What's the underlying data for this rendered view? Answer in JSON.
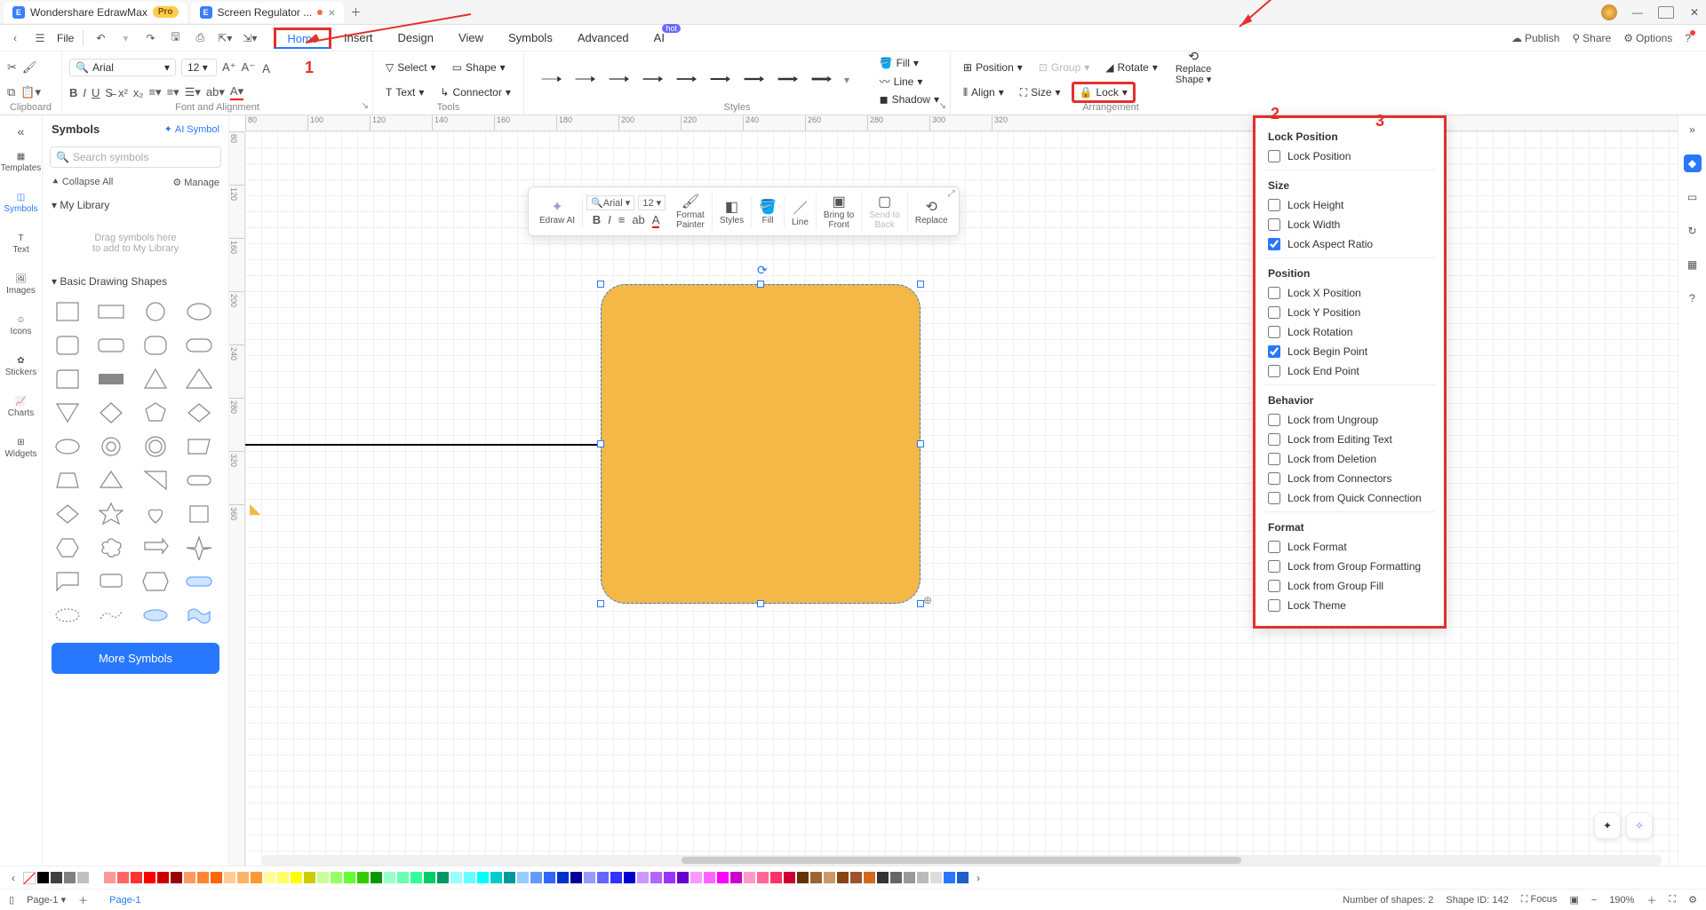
{
  "titlebar": {
    "tab1": "Wondershare EdrawMax",
    "pro": "Pro",
    "tab2": "Screen Regulator ..."
  },
  "topbar": {
    "file": "File",
    "menus": [
      "Home",
      "Insert",
      "Design",
      "View",
      "Symbols",
      "Advanced",
      "AI"
    ],
    "hot": "hot",
    "publish": "Publish",
    "share": "Share",
    "options": "Options"
  },
  "ribbon": {
    "clipboard": "Clipboard",
    "font_alignment": "Font and Alignment",
    "tools": "Tools",
    "styles": "Styles",
    "arrangement": "Arrangement",
    "font": "Arial",
    "fontsize": "12",
    "select": "Select",
    "shape": "Shape",
    "text": "Text",
    "connector": "Connector",
    "fill": "Fill",
    "line": "Line",
    "shadow": "Shadow",
    "position": "Position",
    "group": "Group",
    "align": "Align",
    "size": "Size",
    "rotate": "Rotate",
    "lock": "Lock",
    "replace_shape1": "Replace",
    "replace_shape2": "Shape"
  },
  "rail": {
    "templates": "Templates",
    "symbols": "Symbols",
    "text": "Text",
    "images": "Images",
    "icons": "Icons",
    "stickers": "Stickers",
    "charts": "Charts",
    "widgets": "Widgets"
  },
  "panel": {
    "title": "Symbols",
    "ai_symbol": "AI Symbol",
    "search_placeholder": "Search symbols",
    "collapse": "Collapse All",
    "manage": "Manage",
    "my_library": "My Library",
    "drag_hint1": "Drag symbols here",
    "drag_hint2": "to add to My Library",
    "basic_shapes": "Basic Drawing Shapes",
    "more": "More Symbols"
  },
  "mini": {
    "font": "Arial",
    "size": "12",
    "edraw_ai": "Edraw AI",
    "format_painter": "Format\nPainter",
    "styles": "Styles",
    "fill": "Fill",
    "line": "Line",
    "bring_front": "Bring to\nFront",
    "send_back": "Send to\nBack",
    "replace": "Replace"
  },
  "lock_menu": {
    "h1": "Lock Position",
    "lock_position": "Lock Position",
    "h2": "Size",
    "lock_height": "Lock Height",
    "lock_width": "Lock Width",
    "lock_aspect": "Lock Aspect Ratio",
    "h3": "Position",
    "lock_x": "Lock X Position",
    "lock_y": "Lock Y Position",
    "lock_rot": "Lock Rotation",
    "lock_begin": "Lock Begin Point",
    "lock_end": "Lock End Point",
    "h4": "Behavior",
    "lock_ungroup": "Lock from Ungroup",
    "lock_edit": "Lock from Editing Text",
    "lock_del": "Lock from Deletion",
    "lock_conn": "Lock from Connectors",
    "lock_quick": "Lock from Quick Connection",
    "h5": "Format",
    "lock_format": "Lock Format",
    "lock_groupfmt": "Lock from Group Formatting",
    "lock_groupfill": "Lock from Group Fill",
    "lock_theme": "Lock Theme"
  },
  "ruler_h": [
    "80",
    "100",
    "120",
    "140",
    "160",
    "180",
    "200",
    "220",
    "240",
    "260",
    "280",
    "300",
    "320"
  ],
  "ruler_v": [
    "80",
    "120",
    "160",
    "200",
    "240",
    "280",
    "320",
    "360"
  ],
  "status": {
    "page_select": "Page-1",
    "page_tab": "Page-1",
    "shapes": "Number of shapes: 2",
    "shape_id": "Shape ID: 142",
    "focus": "Focus",
    "zoom": "190%"
  },
  "annotations": {
    "n1": "1",
    "n2": "2",
    "n3": "3"
  },
  "colors": [
    "#000000",
    "#404040",
    "#808080",
    "#c0c0c0",
    "#ffffff",
    "#ff9999",
    "#ff6666",
    "#ff3333",
    "#ff0000",
    "#cc0000",
    "#990000",
    "#ff9966",
    "#ff8533",
    "#ff6600",
    "#ffcc99",
    "#ffb366",
    "#ff9933",
    "#ffff99",
    "#ffff66",
    "#ffff00",
    "#cccc00",
    "#ccff99",
    "#99ff66",
    "#66ff33",
    "#33cc00",
    "#009900",
    "#99ffcc",
    "#66ffb3",
    "#33ff99",
    "#00cc66",
    "#009966",
    "#99ffff",
    "#66ffff",
    "#00ffff",
    "#00cccc",
    "#009999",
    "#99ccff",
    "#6699ff",
    "#3366ff",
    "#0033cc",
    "#000099",
    "#9999ff",
    "#6666ff",
    "#3333ff",
    "#0000cc",
    "#cc99ff",
    "#b366ff",
    "#9933ff",
    "#6600cc",
    "#ff99ff",
    "#ff66ff",
    "#ff00ff",
    "#cc00cc",
    "#ff99cc",
    "#ff6699",
    "#ff3366",
    "#cc0033",
    "#663300",
    "#996633",
    "#cc9966",
    "#8b4513",
    "#a0522d",
    "#d2691e",
    "#333333",
    "#666666",
    "#999999",
    "#bbbbbb",
    "#dddddd",
    "#2878ff",
    "#1e5fcc"
  ]
}
